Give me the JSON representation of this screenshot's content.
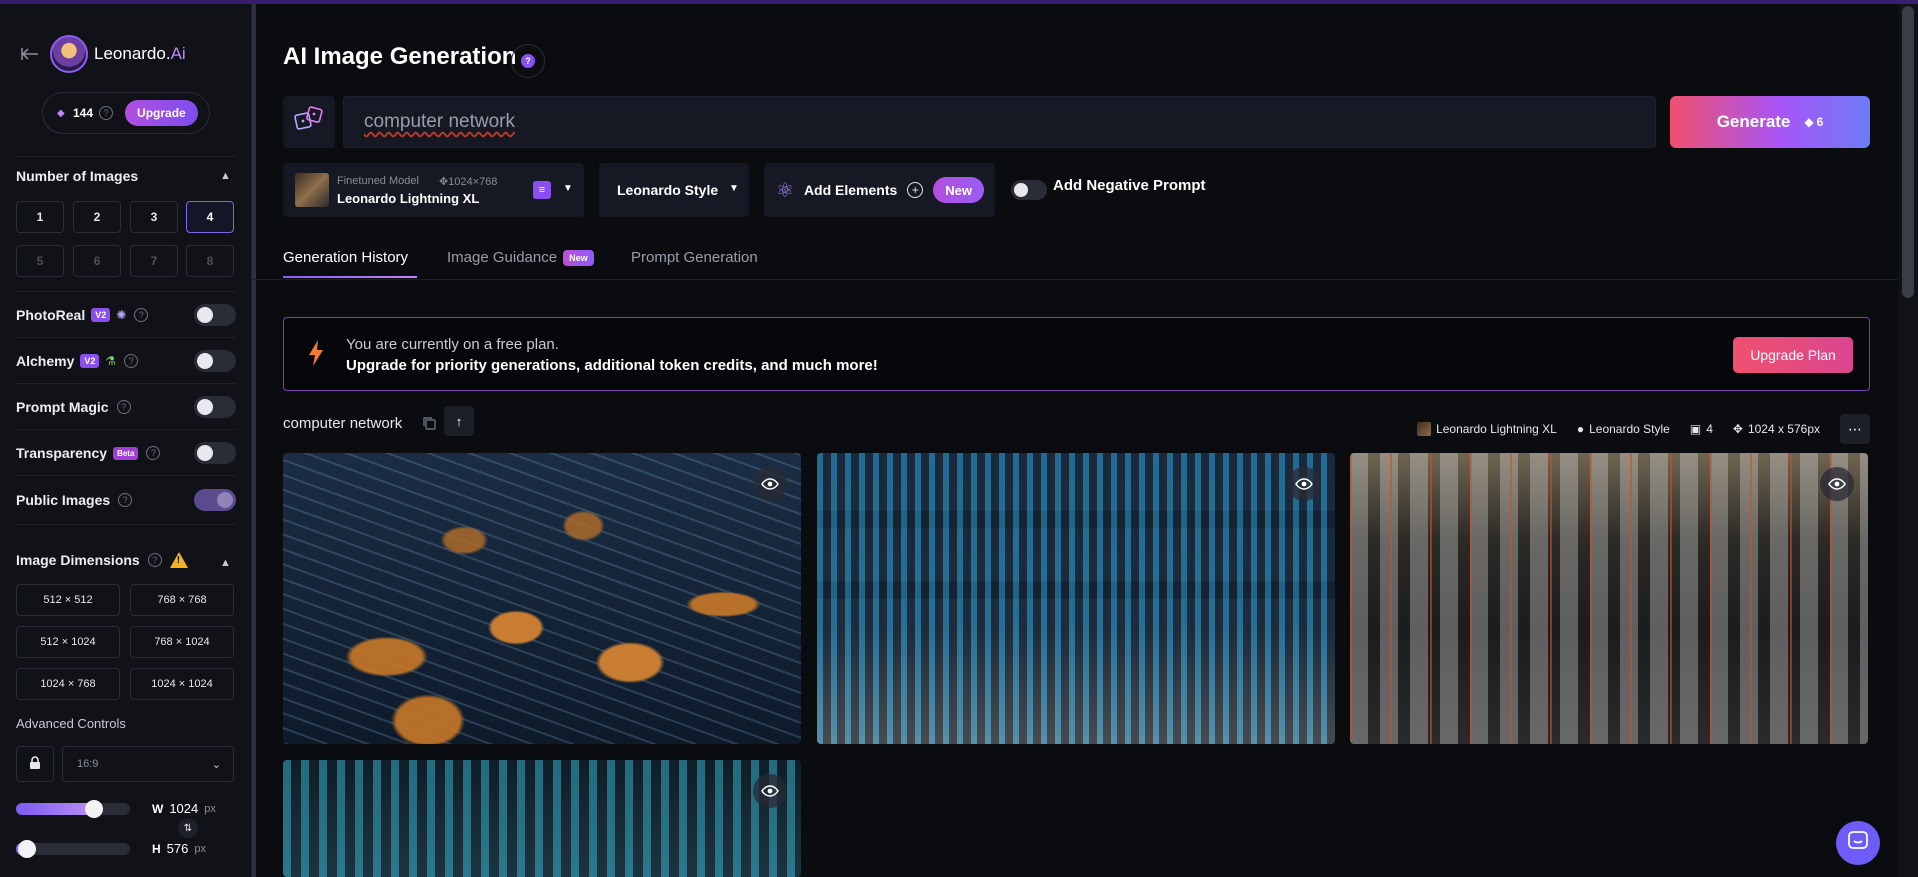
{
  "app": {
    "brand_name": "Leonardo.",
    "brand_suffix": "Ai"
  },
  "sidebar": {
    "tokens": "144",
    "upgrade_label": "Upgrade",
    "number_of_images": {
      "title": "Number of Images",
      "options": [
        "1",
        "2",
        "3",
        "4",
        "5",
        "6",
        "7",
        "8"
      ],
      "selected": "4"
    },
    "toggles": {
      "photoreal": {
        "label": "PhotoReal",
        "badge": "V2",
        "on": false
      },
      "alchemy": {
        "label": "Alchemy",
        "badge": "V2",
        "on": false
      },
      "prompt_magic": {
        "label": "Prompt Magic",
        "on": false
      },
      "transparency": {
        "label": "Transparency",
        "badge": "Beta",
        "on": false
      },
      "public_images": {
        "label": "Public Images",
        "on": true
      }
    },
    "image_dimensions": {
      "title": "Image Dimensions",
      "options": [
        "512 × 512",
        "768 × 768",
        "512 × 1024",
        "768 × 1024",
        "1024 × 768",
        "1024 × 1024"
      ]
    },
    "advanced_controls_label": "Advanced Controls",
    "aspect_ratio": "16:9",
    "width": {
      "letter": "W",
      "value": "1024",
      "unit": "px",
      "fraction": 0.72
    },
    "height": {
      "letter": "H",
      "value": "576",
      "unit": "px",
      "fraction": 0.02
    }
  },
  "main": {
    "title": "AI Image Generation",
    "prompt_value": "computer network",
    "generate": {
      "label": "Generate",
      "cost": "6"
    },
    "model": {
      "type": "Finetuned Model",
      "size": "1024×768",
      "name": "Leonardo Lightning XL"
    },
    "style": "Leonardo Style",
    "elements": {
      "label": "Add Elements",
      "badge": "New"
    },
    "negative_prompt_label": "Add Negative Prompt",
    "tabs": [
      {
        "label": "Generation History"
      },
      {
        "label": "Image Guidance",
        "badge": "New"
      },
      {
        "label": "Prompt Generation"
      }
    ],
    "banner": {
      "line1": "You are currently on a free plan.",
      "line2": "Upgrade for priority generations, additional token credits, and much more!",
      "button": "Upgrade Plan"
    },
    "generation": {
      "prompt": "computer network",
      "model": "Leonardo Lightning XL",
      "style": "Leonardo Style",
      "count": "4",
      "size": "1024 x 576px"
    }
  },
  "colors": {
    "accent": "#8b5cf6",
    "generate_start": "#f0506e",
    "banner_border": "#7a3fb0"
  },
  "icons": [
    "back-arrow-icon",
    "token-icon",
    "help-icon",
    "dice-icon",
    "model-icon",
    "atom-icon",
    "bolt-icon",
    "copy-icon",
    "arrow-up-icon",
    "eye-icon",
    "chat-icon",
    "lock-icon",
    "swap-icon",
    "warning-icon"
  ]
}
